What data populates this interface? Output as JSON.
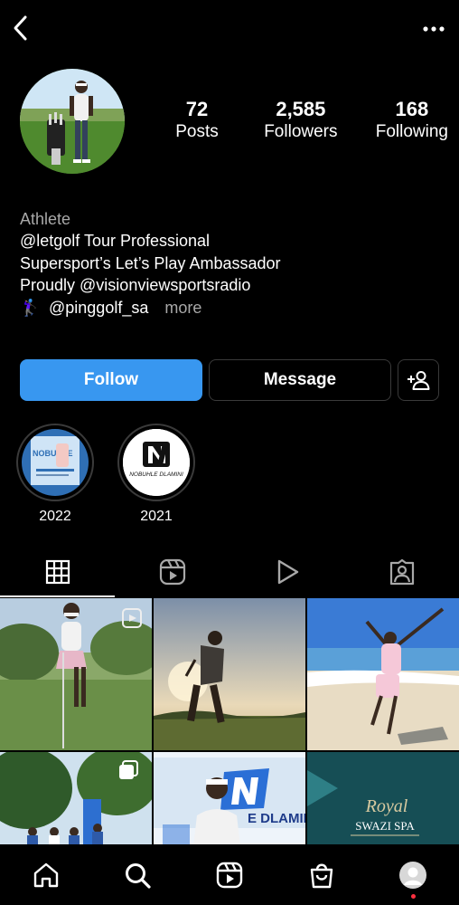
{
  "profile": {
    "stats": [
      {
        "value": "72",
        "label": "Posts"
      },
      {
        "value": "2,585",
        "label": "Followers"
      },
      {
        "value": "168",
        "label": "Following"
      }
    ],
    "bio": {
      "category": "Athlete",
      "lines": [
        "@letgolf Tour Professional",
        "Supersport’s Let’s Play Ambassador",
        "Proudly @visionviewsportsradio"
      ],
      "last_line_emoji": "🏌🏾‍♀️",
      "last_line_handle": "@pinggolf_sa",
      "more_label": "more"
    }
  },
  "actions": {
    "follow_label": "Follow",
    "message_label": "Message"
  },
  "highlights": [
    {
      "label": "2022",
      "cover_text": "NOBUHLE"
    },
    {
      "label": "2021",
      "cover_text": "NOBUHLE DLAMINI"
    }
  ],
  "posts": [
    {
      "caption_text": ""
    },
    {
      "caption_text": ""
    },
    {
      "caption_text": ""
    },
    {
      "caption_text": ""
    },
    {
      "caption_text": "E DLAMINI"
    },
    {
      "caption_text": "Royal",
      "caption_text_2": "SWAZI SPA"
    }
  ],
  "icons": {
    "back": "chevron-left-icon",
    "more": "ellipsis-icon",
    "add_user": "add-user-icon",
    "tabs": [
      "grid-icon",
      "reels-icon",
      "video-play-icon",
      "tagged-icon"
    ],
    "nav": [
      "home-icon",
      "search-icon",
      "reels-icon",
      "shop-icon",
      "profile-icon"
    ]
  },
  "colors": {
    "background": "#000000",
    "follow_button": "#3897f0",
    "secondary_text": "#a8a8a8",
    "notification_dot": "#ff3040"
  }
}
